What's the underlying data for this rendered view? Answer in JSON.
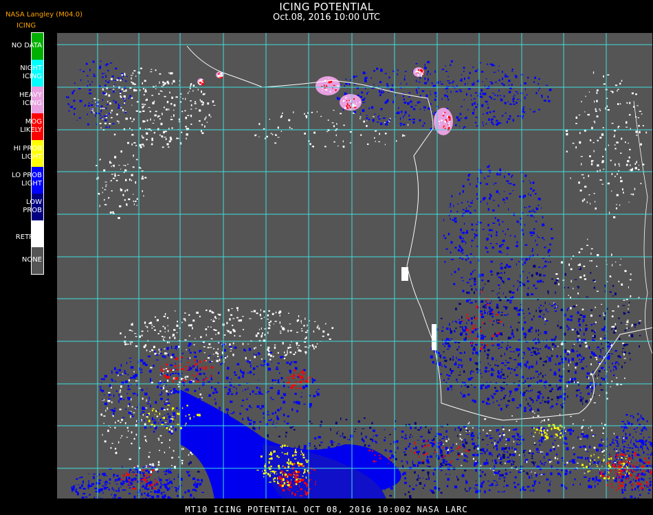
{
  "header": {
    "title": "ICING POTENTIAL",
    "subtitle": "Oct.08, 2016 10:00 UTC",
    "source": "NASA Langley (M04.0)",
    "legend_title": "ICING"
  },
  "legend": [
    {
      "line1": "NO DATA",
      "line2": "",
      "color": "#00b000"
    },
    {
      "line1": "NIGHT",
      "line2": "ICING",
      "color": "#00ffff"
    },
    {
      "line1": "HEAVY",
      "line2": "ICING",
      "color": "#e8a0e0"
    },
    {
      "line1": "MOG",
      "line2": "LIKELY",
      "color": "#ff0000"
    },
    {
      "line1": "HI PROB",
      "line2": "LIGHT",
      "color": "#ffff00"
    },
    {
      "line1": "LO PROB",
      "line2": "LIGHT",
      "color": "#0000ff"
    },
    {
      "line1": "LOW",
      "line2": "PROB",
      "color": "#000080"
    },
    {
      "line1": "NO",
      "line2": "RETRVL",
      "color": "#ffffff"
    },
    {
      "line1": "NONE",
      "line2": "",
      "color": "#555555"
    }
  ],
  "footer": "MT10  ICING POTENTIAL   OCT 08, 2016 10:00Z   NASA LARC",
  "colors": {
    "grid": "#40e0e0",
    "coast": "#ffffff",
    "grid_label": "#d83030"
  }
}
